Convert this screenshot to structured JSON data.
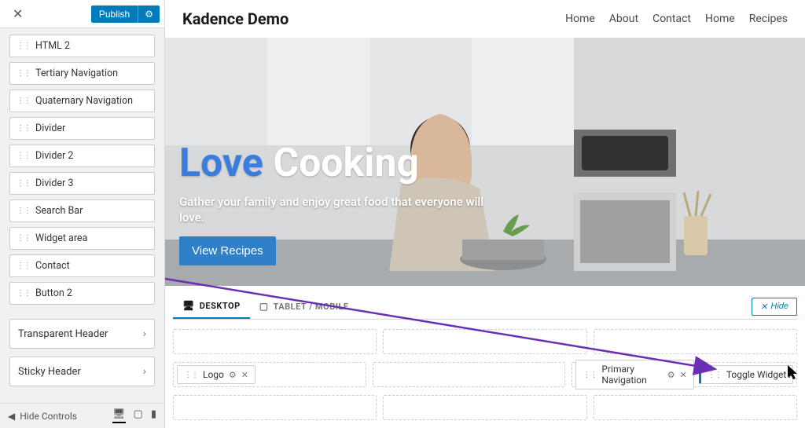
{
  "sidebar": {
    "publish_label": "Publish",
    "available_items": [
      "HTML 2",
      "Tertiary Navigation",
      "Quaternary Navigation",
      "Divider",
      "Divider 2",
      "Divider 3",
      "Search Bar",
      "Widget area",
      "Contact",
      "Button 2"
    ],
    "sections": {
      "transparent": "Transparent Header",
      "sticky": "Sticky Header"
    },
    "hide_controls": "Hide Controls"
  },
  "preview": {
    "site_title": "Kadence Demo",
    "nav": [
      "Home",
      "About",
      "Contact",
      "Home",
      "Recipes"
    ],
    "hero": {
      "title_accent": "Love",
      "title_rest": "Cooking",
      "subtitle": "Gather your family and enjoy great food that everyone will love.",
      "button": "View Recipes"
    }
  },
  "builder": {
    "tab_desktop": "DESKTOP",
    "tab_mobile": "TABLET / MOBILE",
    "hide_label": "Hide",
    "chips": {
      "logo": "Logo",
      "primary_nav": "Primary Navigation",
      "toggle_widget": "Toggle Widget Area"
    }
  }
}
